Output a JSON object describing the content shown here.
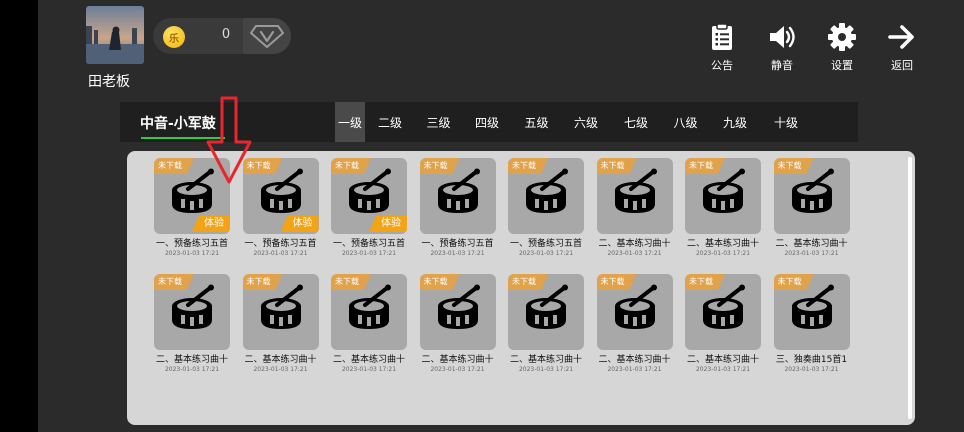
{
  "user": {
    "name": "田老板"
  },
  "wallet": {
    "coin_glyph": "乐",
    "count": "0"
  },
  "actions": [
    {
      "label": "公告",
      "icon": "clipboard-icon"
    },
    {
      "label": "静音",
      "icon": "speaker-icon"
    },
    {
      "label": "设置",
      "icon": "gear-icon"
    },
    {
      "label": "返回",
      "icon": "arrow-right-icon"
    }
  ],
  "category": {
    "label": "中音-小军鼓"
  },
  "levels": {
    "active_index": 0,
    "items": [
      "一级",
      "二级",
      "三级",
      "四级",
      "五级",
      "六级",
      "七级",
      "八级",
      "九级",
      "十级"
    ]
  },
  "colors": {
    "accent_green": "#2ecc40",
    "badge_orange": "#e0a24a",
    "trial_orange": "#f2a316",
    "panel_bg": "#d6d6d6"
  },
  "items": [
    {
      "title": "一、预备练习五首",
      "date": "2023-01-03 17:21",
      "badge": "未下载",
      "trial": "体验"
    },
    {
      "title": "一、预备练习五首",
      "date": "2023-01-03 17:21",
      "badge": "未下载",
      "trial": "体验"
    },
    {
      "title": "一、预备练习五首",
      "date": "2023-01-03 17:21",
      "badge": "未下载",
      "trial": "体验"
    },
    {
      "title": "一、预备练习五首",
      "date": "2023-01-03 17:21",
      "badge": "未下载",
      "trial": ""
    },
    {
      "title": "一、预备练习五首",
      "date": "2023-01-03 17:21",
      "badge": "未下载",
      "trial": ""
    },
    {
      "title": "二、基本练习曲十",
      "date": "2023-01-03 17:21",
      "badge": "未下载",
      "trial": ""
    },
    {
      "title": "二、基本练习曲十",
      "date": "2023-01-03 17:21",
      "badge": "未下载",
      "trial": ""
    },
    {
      "title": "二、基本练习曲十",
      "date": "2023-01-03 17:21",
      "badge": "未下载",
      "trial": ""
    },
    {
      "title": "二、基本练习曲十",
      "date": "2023-01-03 17:21",
      "badge": "未下载",
      "trial": ""
    },
    {
      "title": "二、基本练习曲十",
      "date": "2023-01-03 17:21",
      "badge": "未下载",
      "trial": ""
    },
    {
      "title": "二、基本练习曲十",
      "date": "2023-01-03 17:21",
      "badge": "未下载",
      "trial": ""
    },
    {
      "title": "二、基本练习曲十",
      "date": "2023-01-03 17:21",
      "badge": "未下载",
      "trial": ""
    },
    {
      "title": "二、基本练习曲十",
      "date": "2023-01-03 17:21",
      "badge": "未下载",
      "trial": ""
    },
    {
      "title": "二、基本练习曲十",
      "date": "2023-01-03 17:21",
      "badge": "未下载",
      "trial": ""
    },
    {
      "title": "二、基本练习曲十",
      "date": "2023-01-03 17:21",
      "badge": "未下载",
      "trial": ""
    },
    {
      "title": "三、独奏曲15首1",
      "date": "2023-01-03 17:21",
      "badge": "未下载",
      "trial": ""
    }
  ]
}
